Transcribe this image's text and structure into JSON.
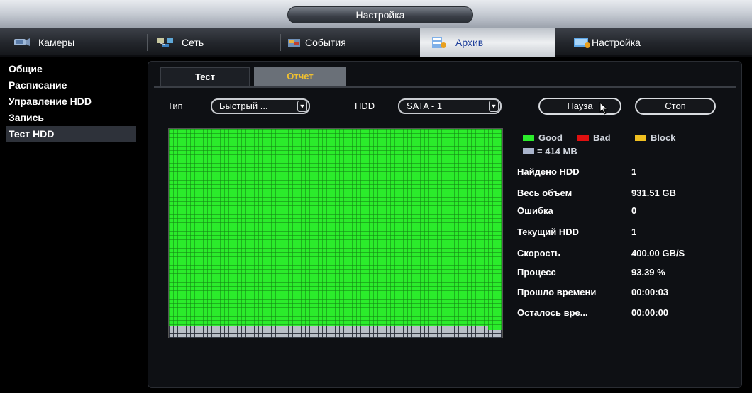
{
  "window": {
    "title": "Настройка"
  },
  "tabs": [
    {
      "label": "Камеры",
      "icon": "camera-icon"
    },
    {
      "label": "Сеть",
      "icon": "network-icon"
    },
    {
      "label": "События",
      "icon": "events-icon"
    },
    {
      "label": "Архив",
      "icon": "archive-icon",
      "active": true
    },
    {
      "label": "Настройка",
      "icon": "system-settings-icon"
    }
  ],
  "sidebar": {
    "items": [
      {
        "label": "Общие"
      },
      {
        "label": "Расписание"
      },
      {
        "label": "Управление HDD"
      },
      {
        "label": "Запись"
      },
      {
        "label": "Тест HDD",
        "active": true
      }
    ]
  },
  "panel": {
    "tabs": {
      "test": "Тест",
      "report": "Отчет"
    },
    "type_label": "Тип",
    "type_value": "Быстрый ...",
    "hdd_label": "HDD",
    "hdd_value": "SATA - 1",
    "pause_button": "Пауза",
    "stop_button": "Стоп",
    "legend": {
      "good": "Good",
      "bad": "Bad",
      "block": "Block",
      "size": "= 414 MB",
      "colors": {
        "good": "#2bec2b",
        "bad": "#e01010",
        "block": "#f0c020",
        "size": "#a9b4cc"
      }
    },
    "info": [
      {
        "key": "Найдено HDD",
        "value": "1"
      },
      {
        "key": "Весь объем",
        "value": "931.51 GB"
      },
      {
        "key": "Ошибка",
        "value": "0"
      },
      {
        "key": "Текущий HDD",
        "value": "1"
      },
      {
        "key": "Скорость",
        "value": "400.00 GB/S"
      },
      {
        "key": "Процесс",
        "value": "93.39 %"
      },
      {
        "key": "Прошло времени",
        "value": "00:00:03"
      },
      {
        "key": "Осталось вре...",
        "value": "00:00:00"
      }
    ]
  }
}
